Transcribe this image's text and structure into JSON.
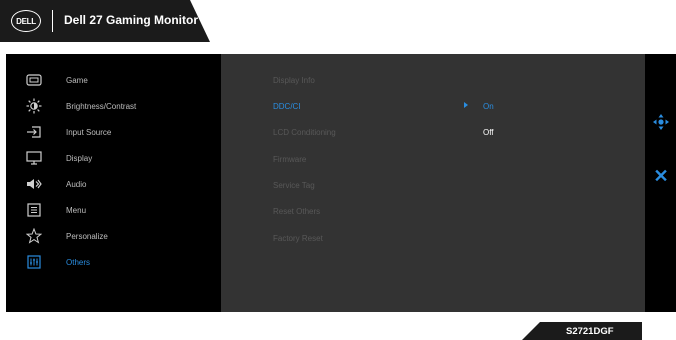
{
  "header": {
    "logo": "DELL",
    "title": "Dell 27 Gaming Monitor"
  },
  "menu": {
    "items": [
      {
        "label": "Game",
        "icon": "game-icon",
        "selected": false
      },
      {
        "label": "Brightness/Contrast",
        "icon": "brightness-icon",
        "selected": false
      },
      {
        "label": "Input Source",
        "icon": "input-source-icon",
        "selected": false
      },
      {
        "label": "Display",
        "icon": "display-icon",
        "selected": false
      },
      {
        "label": "Audio",
        "icon": "audio-icon",
        "selected": false
      },
      {
        "label": "Menu",
        "icon": "menu-icon",
        "selected": false
      },
      {
        "label": "Personalize",
        "icon": "star-icon",
        "selected": false
      },
      {
        "label": "Others",
        "icon": "others-icon",
        "selected": true
      }
    ]
  },
  "submenu": {
    "items": [
      {
        "label": "Display Info"
      },
      {
        "label": "DDC/CI"
      },
      {
        "label": "LCD Conditioning"
      },
      {
        "label": "Firmware"
      },
      {
        "label": "Service Tag"
      },
      {
        "label": "Reset Others"
      },
      {
        "label": "Factory Reset"
      }
    ],
    "options": [
      "On",
      "Off"
    ]
  },
  "model": "S2721DGF",
  "colors": {
    "accent": "#2a8de0",
    "panel": "#000000",
    "content": "#333333",
    "header": "#1b1b1b"
  }
}
